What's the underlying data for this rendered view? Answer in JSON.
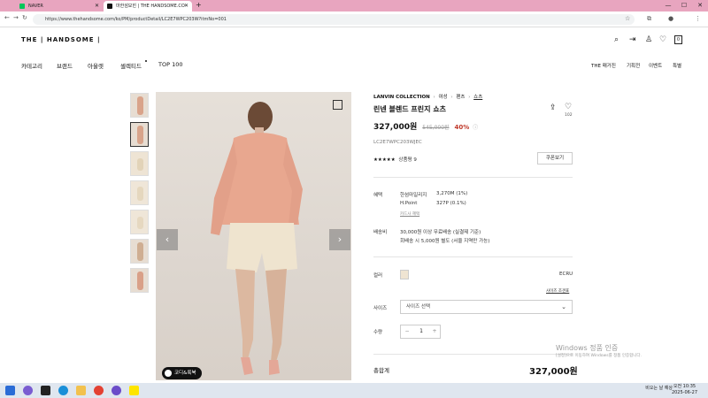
{
  "browser": {
    "tabs": [
      {
        "title": "NAVER",
        "favicon_color": "#03c75a"
      },
      {
        "title": "마한섬모힌 | THE HANDSOME.CO",
        "favicon_color": "#111111"
      }
    ],
    "url": "https://www.thehandsome.com/ko/PM/productDetail/LC2E7WPC203W?itmNo=001",
    "new_tab": "+",
    "minimize": "—",
    "maximize": "☐",
    "close": "✕"
  },
  "site": {
    "logo": "THE | HANDSOME |",
    "gnb_left": [
      "카테고리",
      "브랜드",
      "아울렛",
      "셀렉티드",
      "TOP 100"
    ],
    "gnb_right": [
      "THE 매거진",
      "기획전",
      "이벤트",
      "특별"
    ],
    "cart_count": "0"
  },
  "product": {
    "brand": "LANVIN COLLECTION",
    "crumb_1": "여성",
    "crumb_2": "팬츠",
    "crumb_3": "쇼츠",
    "title": "린넨 블렌드 프린지 쇼츠",
    "price": "327,000원",
    "orig_price": "545,000원",
    "discount": "40%",
    "like_count": "102",
    "code": "LC2E7WPC203WJEC",
    "stars": "★★★★★",
    "review_label": "상품평 9",
    "coupon_label": "쿠폰보기",
    "benefit_label": "혜택",
    "benefit_1_name": "한섬마일리지",
    "benefit_1_value": "3,270M (1%)",
    "benefit_2_name": "H.Point",
    "benefit_2_value": "327P (0.1%)",
    "card_benefit": "카드사 혜택",
    "shipping_label": "배송비",
    "shipping_1": "30,000원 이상 무료배송 (실결제 기준)",
    "shipping_2": "회배송 시 5,000원 별도 (서울 지역만 가능)",
    "color_label": "컬러",
    "color_name": "ECRU",
    "size_guide": "사이즈 조견표",
    "size_label": "사이즈",
    "size_placeholder": "사이즈 선택",
    "qty_label": "수량",
    "qty": "1",
    "total_label": "총합계",
    "total_price": "327,000원",
    "coordi_label": "코디&룩북"
  },
  "windows": {
    "watermark_1": "Windows 정품 인증",
    "watermark_2": "[설정]으로 이동하여 Windows를 정품 인증합니다.",
    "tray": "비오는 날 예상",
    "time": "오전 10:35",
    "date": "2025-06-27"
  }
}
